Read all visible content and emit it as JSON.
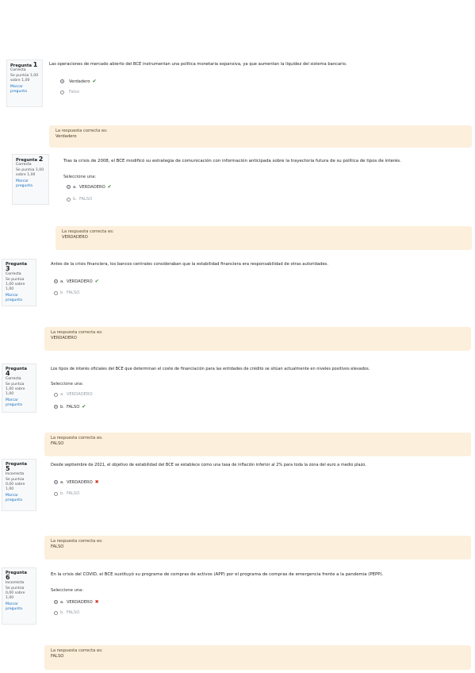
{
  "questions": [
    {
      "qlabel": "Pregunta",
      "qnum": "1",
      "state": "Correcta",
      "grade": "Se puntúa 1,00 sobre 1,00",
      "flag": "Marcar pregunta",
      "text": "Las operaciones de mercado abierto del BCE instrumentan una política monetaria expansiva, ya que aumentan la liquidez del sistema bancario.",
      "prompt": "",
      "options": [
        {
          "letter": "",
          "label": "Verdadero",
          "selected": true,
          "mark": "correct"
        },
        {
          "letter": "",
          "label": "Falso",
          "selected": false,
          "mark": ""
        }
      ],
      "feedback_label": "La respuesta correcta es:",
      "feedback_answer": "Verdadero"
    },
    {
      "qlabel": "Pregunta",
      "qnum": "2",
      "state": "Correcta",
      "grade": "Se puntúa 1,00 sobre 1,00",
      "flag": "Marcar pregunta",
      "text": "Tras la crisis de 2008, el BCE modificó su estrategia de comunicación con información anticipada sobre la trayectoria futura de su política de tipos de interés.",
      "prompt": "Seleccione una:",
      "options": [
        {
          "letter": "a.",
          "label": "VERDADERO",
          "selected": true,
          "mark": "correct"
        },
        {
          "letter": "b.",
          "label": "FALSO",
          "selected": false,
          "mark": ""
        }
      ],
      "feedback_label": "La respuesta correcta es:",
      "feedback_answer": "VERDADERO"
    },
    {
      "qlabel": "Pregunta",
      "qnum": "3",
      "state": "Correcta",
      "grade": "Se puntúa 1,00 sobre 1,00",
      "flag": "Marcar pregunta",
      "text": "Antes de la crisis financiera, los bancos centrales consideraban que la estabilidad financiera era responsabilidad de otras autoridades.",
      "prompt": "",
      "options": [
        {
          "letter": "a.",
          "label": "VERDADERO",
          "selected": true,
          "mark": "correct"
        },
        {
          "letter": "b.",
          "label": "FALSO",
          "selected": false,
          "mark": ""
        }
      ],
      "feedback_label": "La respuesta correcta es:",
      "feedback_answer": "VERDADERO"
    },
    {
      "qlabel": "Pregunta",
      "qnum": "4",
      "state": "Correcta",
      "grade": "Se puntúa 1,00 sobre 1,00",
      "flag": "Marcar pregunta",
      "text": "Los tipos de interés oficiales del BCE que determinan el coste de financiación para las entidades de crédito se sitúan actualmente en niveles positivos elevados.",
      "prompt": "Seleccione una:",
      "options": [
        {
          "letter": "a.",
          "label": "VERDADERO",
          "selected": false,
          "mark": ""
        },
        {
          "letter": "b.",
          "label": "FALSO",
          "selected": true,
          "mark": "correct"
        }
      ],
      "feedback_label": "La respuesta correcta es:",
      "feedback_answer": "FALSO"
    },
    {
      "qlabel": "Pregunta",
      "qnum": "5",
      "state": "Incorrecta",
      "grade": "Se puntúa 0,00 sobre 1,00",
      "flag": "Marcar pregunta",
      "text": "Desde septiembre de 2021, el objetivo de estabilidad del BCE se establece como una tasa de inflación inferior al 2% para toda la zona del euro a medio plazo.",
      "prompt": "",
      "options": [
        {
          "letter": "a.",
          "label": "VERDADERO",
          "selected": true,
          "mark": "wrong"
        },
        {
          "letter": "b.",
          "label": "FALSO",
          "selected": false,
          "mark": ""
        }
      ],
      "feedback_label": "La respuesta correcta es:",
      "feedback_answer": "FALSO"
    },
    {
      "qlabel": "Pregunta",
      "qnum": "6",
      "state": "Incorrecta",
      "grade": "Se puntúa 0,00 sobre 1,00",
      "flag": "Marcar pregunta",
      "text": "En la crisis del COVID, el BCE sustituyó su programa de compras de activos (APP) por el programa de compras de emergencia frente a la pandemia (PEPP).",
      "prompt": "Seleccione una:",
      "options": [
        {
          "letter": "a.",
          "label": "VERDADERO",
          "selected": true,
          "mark": "wrong"
        },
        {
          "letter": "b.",
          "label": "FALSO",
          "selected": false,
          "mark": ""
        }
      ],
      "feedback_label": "La respuesta correcta es:",
      "feedback_answer": "FALSO"
    }
  ],
  "icons": {
    "correct": "✔",
    "wrong": "✖"
  },
  "colors": {
    "feedback_bg": "#fcefdc",
    "correct": "#357a32",
    "incorrect": "#ca3120"
  }
}
